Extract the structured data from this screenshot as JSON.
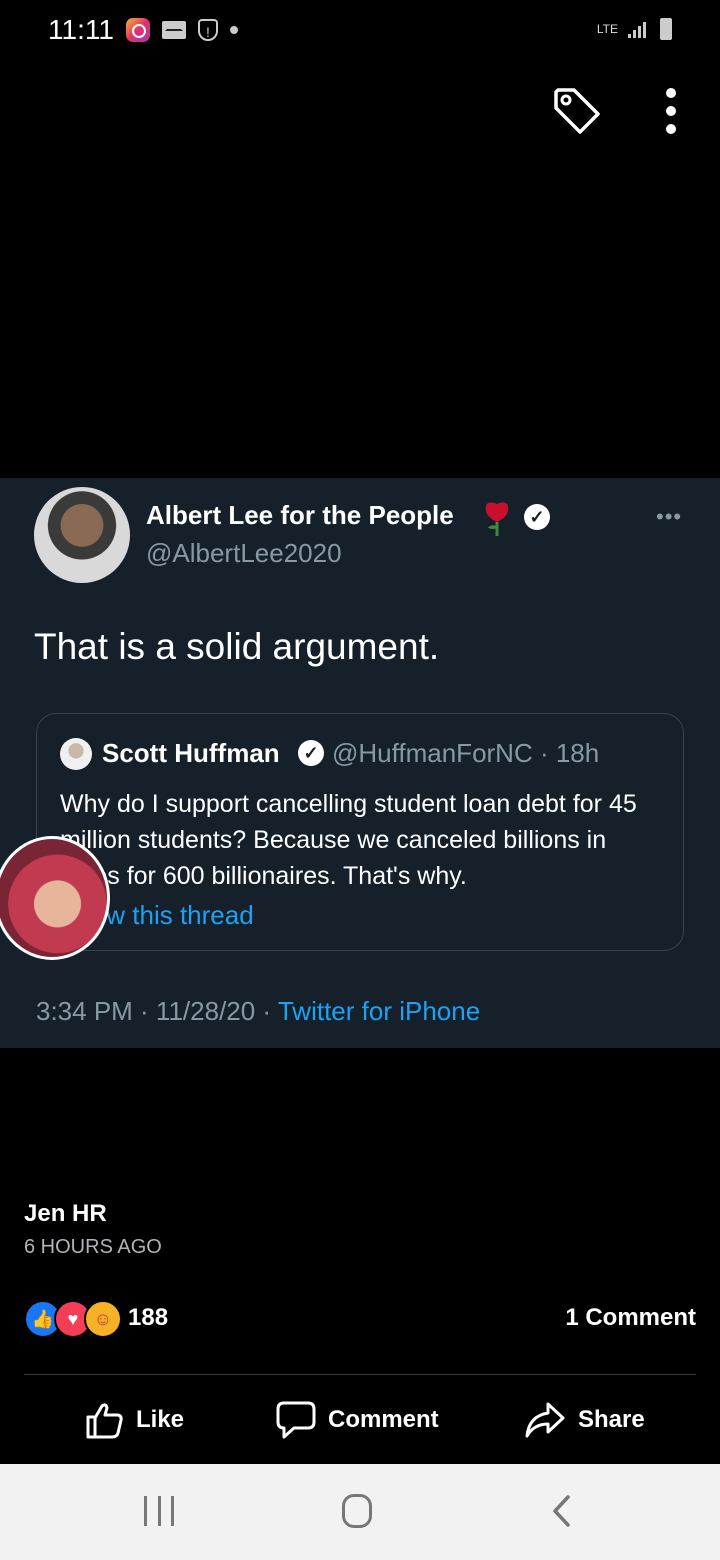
{
  "status_bar": {
    "time": "11:11",
    "network": "LTE"
  },
  "tweet": {
    "display_name": "Albert Lee for the People",
    "handle": "@AlbertLee2020",
    "text": "That is a solid argument.",
    "quote": {
      "display_name": "Scott Huffman",
      "handle_time": "@HuffmanForNC · 18h",
      "text": "Why do I support cancelling student loan debt for 45 million students?  Because we canceled billions in taxes for 600 billionaires.  That's why.",
      "show_thread": "Show this thread"
    },
    "timestamp": "3:34 PM · 11/28/20 · ",
    "source": "Twitter for iPhone"
  },
  "post": {
    "author": "Jen HR",
    "time_ago": "6 HOURS AGO",
    "reaction_count": "188",
    "comment_count": "1 Comment",
    "actions": {
      "like": "Like",
      "comment": "Comment",
      "share": "Share"
    }
  },
  "colors": {
    "tweet_bg": "#15202b",
    "link": "#1da1f2",
    "secondary": "#8899a6"
  }
}
